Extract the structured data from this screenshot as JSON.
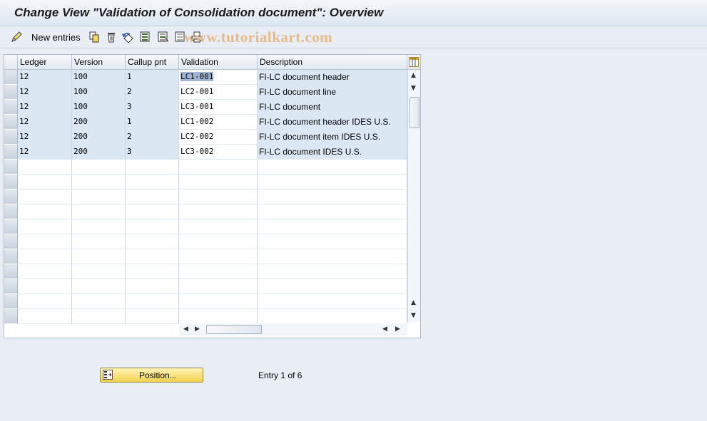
{
  "window": {
    "title": "Change View \"Validation of Consolidation document\": Overview"
  },
  "watermark": "www.tutorialkart.com",
  "toolbar": {
    "new_entries_label": "New entries",
    "icons": [
      "edit-pencil-icon",
      "copy-icon",
      "delete-icon",
      "undo-icon",
      "select-all-icon",
      "select-block-icon",
      "deselect-all-icon",
      "print-icon"
    ]
  },
  "table": {
    "columns": [
      "Ledger",
      "Version",
      "Callup pnt",
      "Validation",
      "Description"
    ],
    "rows": [
      {
        "ledger": "12",
        "version": "100",
        "callup": "1",
        "validation": "LC1-001",
        "description": "FI-LC document header"
      },
      {
        "ledger": "12",
        "version": "100",
        "callup": "2",
        "validation": "LC2-001",
        "description": "FI-LC document line"
      },
      {
        "ledger": "12",
        "version": "100",
        "callup": "3",
        "validation": "LC3-001",
        "description": "FI-LC document"
      },
      {
        "ledger": "12",
        "version": "200",
        "callup": "1",
        "validation": "LC1-002",
        "description": "FI-LC document header IDES U.S."
      },
      {
        "ledger": "12",
        "version": "200",
        "callup": "2",
        "validation": "LC2-002",
        "description": "FI-LC document item IDES U.S."
      },
      {
        "ledger": "12",
        "version": "200",
        "callup": "3",
        "validation": "LC3-002",
        "description": "FI-LC document IDES U.S."
      }
    ],
    "selected_cell": "LC1-001",
    "empty_rows": 11
  },
  "footer": {
    "position_button_label": "Position...",
    "entry_text": "Entry 1 of 6"
  },
  "colors": {
    "readonly_cell": "#dbe7f3",
    "button_yellow": "#f2d24c",
    "watermark": "#e6b98b"
  }
}
